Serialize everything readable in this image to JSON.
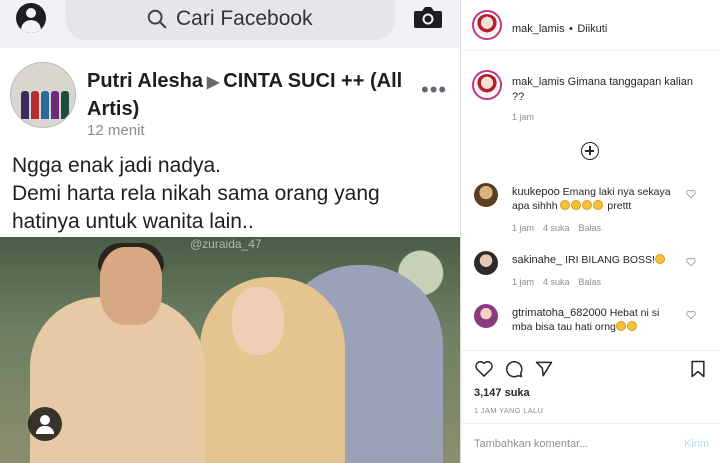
{
  "facebook": {
    "search_placeholder": "Cari Facebook",
    "post": {
      "author": "Putri Alesha",
      "group": "CINTA SUCI ++ (All Artis)",
      "time": "12 menit",
      "text_line1": "Ngga enak jadi nadya.",
      "text_line2": "Demi harta rela nikah sama orang yang hatinya untuk wanita lain..",
      "photo_watermark": "@zuraida_47"
    }
  },
  "instagram": {
    "header": {
      "username": "mak_lamis",
      "separator": "•",
      "follow_status": "Diikuti"
    },
    "caption": {
      "username": "mak_lamis",
      "text": "Gimana tanggapan kalian ??",
      "time": "1 jam"
    },
    "comments": [
      {
        "username": "kuukepoo",
        "text": "Emang laki nya sekaya apa sihhh",
        "text_suffix": "prettt",
        "emoji_count": 4,
        "time": "1 jam",
        "likes": "4 suka",
        "reply": "Balas"
      },
      {
        "username": "sakinahe_",
        "text": "IRI BILANG BOSS!",
        "text_suffix": "",
        "emoji_count": 1,
        "time": "1 jam",
        "likes": "4 suka",
        "reply": "Balas"
      },
      {
        "username": "gtrimatoha_682000",
        "text": "Hebat ni si mba bisa tau hati orng",
        "text_suffix": "",
        "emoji_count": 2,
        "time": "1 jam",
        "likes": "4 suka",
        "reply": "Balas"
      }
    ],
    "likes": "3,147 suka",
    "date": "1 JAM YANG LALU",
    "comment_placeholder": "Tambahkan komentar...",
    "post_button": "Kirim"
  }
}
